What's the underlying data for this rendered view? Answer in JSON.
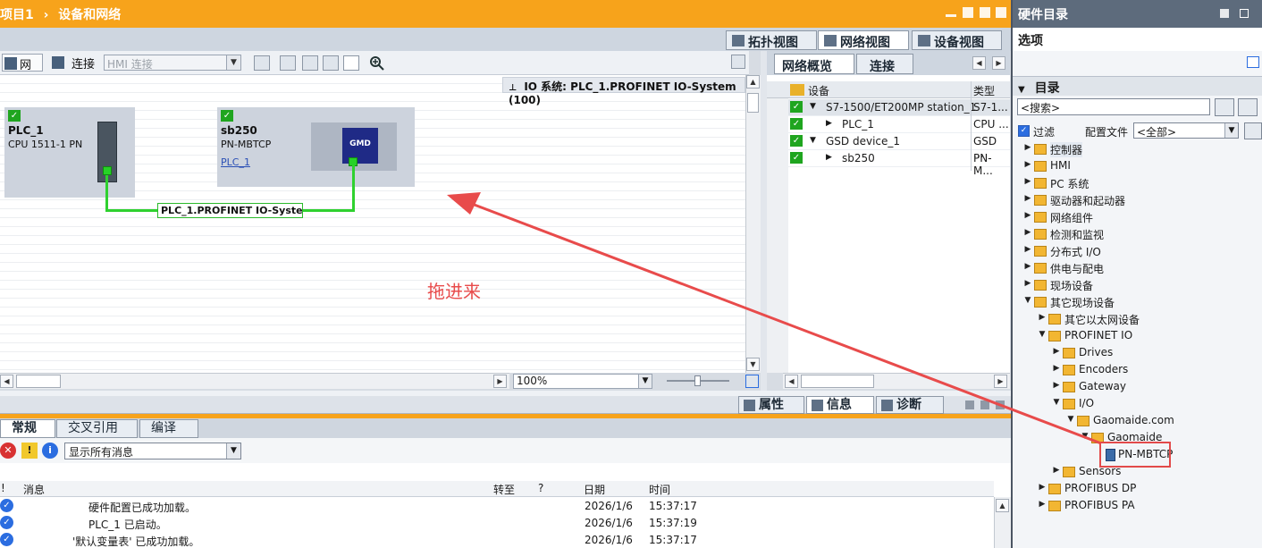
{
  "window": {
    "breadcrumb_project": "项目1",
    "breadcrumb_sep": "›",
    "breadcrumb_page": "设备和网络"
  },
  "view_tabs": [
    {
      "label": "拓扑视图",
      "active": false
    },
    {
      "label": "网络视图",
      "active": true
    },
    {
      "label": "设备视图",
      "active": false
    }
  ],
  "toolbar": {
    "network_label": "网络",
    "connect_label": "连接",
    "hmi_connect_value": "HMI 连接"
  },
  "canvas": {
    "io_system_label": "IO 系统: PLC_1.PROFINET IO-System (100)",
    "devices": [
      {
        "name": "PLC_1",
        "type": "CPU 1511-1 PN",
        "link": ""
      },
      {
        "name": "sb250",
        "type": "PN-MBTCP",
        "link": "PLC_1",
        "logo": "GMD"
      }
    ],
    "network_label": "PLC_1.PROFINET IO-Syste...",
    "annotation": "拖进来",
    "zoom": "100%"
  },
  "overview": {
    "tabs": [
      {
        "label": "网络概览",
        "active": true
      },
      {
        "label": "连接",
        "active": false
      }
    ],
    "columns": [
      "设备",
      "类型"
    ],
    "rows": [
      {
        "device": "S7-1500/ET200MP station_1",
        "type": "S7-1...",
        "level": 0,
        "twisty": "▼"
      },
      {
        "device": "PLC_1",
        "type": "CPU ...",
        "level": 1,
        "twisty": "▶"
      },
      {
        "device": "GSD device_1",
        "type": "GSD ...",
        "level": 0,
        "twisty": "▼"
      },
      {
        "device": "sb250",
        "type": "PN-M...",
        "level": 1,
        "twisty": "▶"
      }
    ]
  },
  "inspector": {
    "tabs": [
      {
        "label": "属性",
        "active": false
      },
      {
        "label": "信息",
        "active": true
      },
      {
        "label": "诊断",
        "active": false
      }
    ],
    "sub_tabs": [
      {
        "label": "常规",
        "active": true
      },
      {
        "label": "交叉引用",
        "active": false
      },
      {
        "label": "编译",
        "active": false
      }
    ],
    "filter_value": "显示所有消息",
    "columns": {
      "bang": "!",
      "message": "消息",
      "goto": "转至",
      "q": "?",
      "date": "日期",
      "time": "时间"
    },
    "messages": [
      {
        "text": "硬件配置已成功加载。",
        "date": "2026/1/6",
        "time": "15:37:17"
      },
      {
        "text": "PLC_1 已启动。",
        "date": "2026/1/6",
        "time": "15:37:19"
      },
      {
        "text": "'默认变量表' 已成功加载。",
        "date": "2026/1/6",
        "time": "15:37:17"
      }
    ]
  },
  "catalog": {
    "title": "硬件目录",
    "options": "选项",
    "section": "目录",
    "search_placeholder": "<搜索>",
    "filter_label": "过滤",
    "profile_label": "配置文件",
    "profile_value": "<全部>",
    "tree": [
      {
        "label": "控制器",
        "indent": 0,
        "twisty": "▶",
        "selected": true
      },
      {
        "label": "HMI",
        "indent": 0,
        "twisty": "▶"
      },
      {
        "label": "PC 系统",
        "indent": 0,
        "twisty": "▶"
      },
      {
        "label": "驱动器和起动器",
        "indent": 0,
        "twisty": "▶"
      },
      {
        "label": "网络组件",
        "indent": 0,
        "twisty": "▶"
      },
      {
        "label": "检测和监视",
        "indent": 0,
        "twisty": "▶"
      },
      {
        "label": "分布式 I/O",
        "indent": 0,
        "twisty": "▶"
      },
      {
        "label": "供电与配电",
        "indent": 0,
        "twisty": "▶"
      },
      {
        "label": "现场设备",
        "indent": 0,
        "twisty": "▶"
      },
      {
        "label": "其它现场设备",
        "indent": 0,
        "twisty": "▼"
      },
      {
        "label": "其它以太网设备",
        "indent": 1,
        "twisty": "▶"
      },
      {
        "label": "PROFINET IO",
        "indent": 1,
        "twisty": "▼"
      },
      {
        "label": "Drives",
        "indent": 2,
        "twisty": "▶"
      },
      {
        "label": "Encoders",
        "indent": 2,
        "twisty": "▶"
      },
      {
        "label": "Gateway",
        "indent": 2,
        "twisty": "▶"
      },
      {
        "label": "I/O",
        "indent": 2,
        "twisty": "▼"
      },
      {
        "label": "Gaomaide.com",
        "indent": 3,
        "twisty": "▼"
      },
      {
        "label": "Gaomaide",
        "indent": 4,
        "twisty": "▼"
      },
      {
        "label": "PN-MBTCP",
        "indent": 5,
        "twisty": "",
        "leaf": true
      },
      {
        "label": "Sensors",
        "indent": 2,
        "twisty": "▶"
      },
      {
        "label": "PROFIBUS DP",
        "indent": 1,
        "twisty": "▶"
      },
      {
        "label": "PROFIBUS PA",
        "indent": 1,
        "twisty": "▶"
      }
    ]
  },
  "colors": {
    "title_orange": "#f7a31b",
    "ok_green": "#1fa51f",
    "network_green": "#2fd12f",
    "annotation_red": "#e84b4b"
  }
}
